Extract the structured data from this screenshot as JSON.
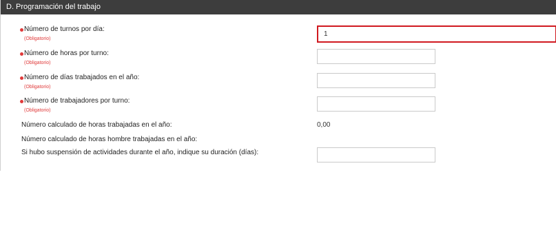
{
  "section": {
    "title": "D. Programación del trabajo"
  },
  "required_label": "(Obligatorio)",
  "fields": [
    {
      "label": "Número de turnos por día:",
      "value": "1",
      "required": true
    },
    {
      "label": "Número de horas por turno:",
      "value": "",
      "required": true
    },
    {
      "label": "Número de días trabajados en el año:",
      "value": "",
      "required": true
    },
    {
      "label": "Número de trabajadores por turno:",
      "value": "",
      "required": true
    }
  ],
  "computed": [
    {
      "label": "Número calculado de horas trabajadas en el año:",
      "value": "0,00"
    },
    {
      "label": "Número calculado de horas hombre trabajadas en el año:",
      "value": ""
    }
  ],
  "suspension": {
    "label": "Si hubo suspensión de actividades durante el año, indique su duración (días):",
    "value": ""
  },
  "colors": {
    "header_bg": "#3d3d3d",
    "required": "#e03a3a",
    "active_border": "#d0191f"
  }
}
